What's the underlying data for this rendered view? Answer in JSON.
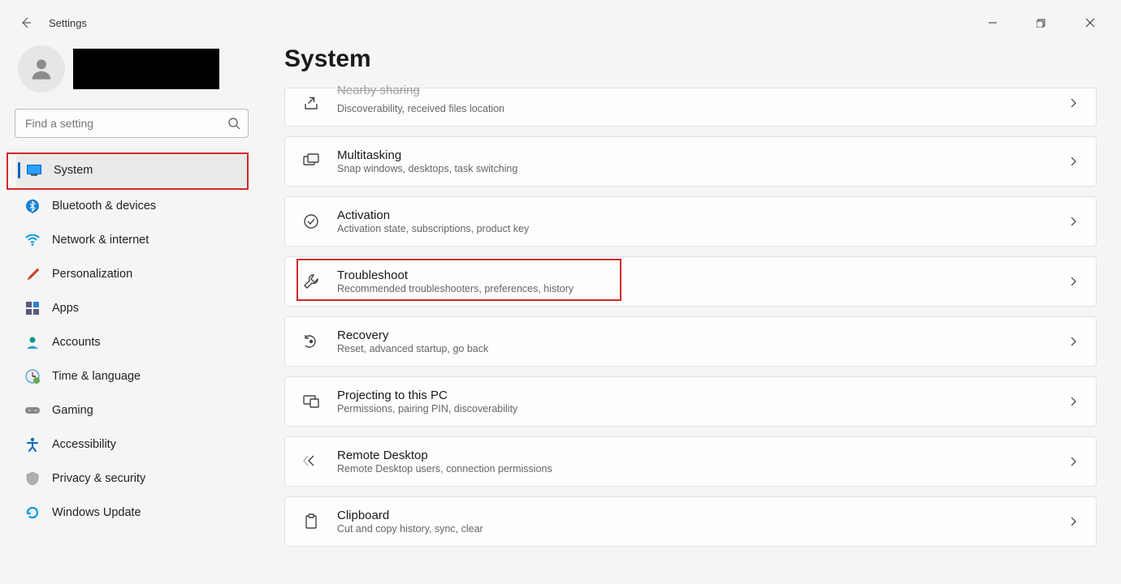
{
  "app_title": "Settings",
  "search_placeholder": "Find a setting",
  "sidebar": {
    "items": [
      {
        "label": "System",
        "selected": true
      },
      {
        "label": "Bluetooth & devices"
      },
      {
        "label": "Network & internet"
      },
      {
        "label": "Personalization"
      },
      {
        "label": "Apps"
      },
      {
        "label": "Accounts"
      },
      {
        "label": "Time & language"
      },
      {
        "label": "Gaming"
      },
      {
        "label": "Accessibility"
      },
      {
        "label": "Privacy & security"
      },
      {
        "label": "Windows Update"
      }
    ]
  },
  "page_title": "System",
  "cards": [
    {
      "title": "Nearby sharing",
      "sub": "Discoverability, received files location"
    },
    {
      "title": "Multitasking",
      "sub": "Snap windows, desktops, task switching"
    },
    {
      "title": "Activation",
      "sub": "Activation state, subscriptions, product key"
    },
    {
      "title": "Troubleshoot",
      "sub": "Recommended troubleshooters, preferences, history"
    },
    {
      "title": "Recovery",
      "sub": "Reset, advanced startup, go back"
    },
    {
      "title": "Projecting to this PC",
      "sub": "Permissions, pairing PIN, discoverability"
    },
    {
      "title": "Remote Desktop",
      "sub": "Remote Desktop users, connection permissions"
    },
    {
      "title": "Clipboard",
      "sub": "Cut and copy history, sync, clear"
    }
  ]
}
